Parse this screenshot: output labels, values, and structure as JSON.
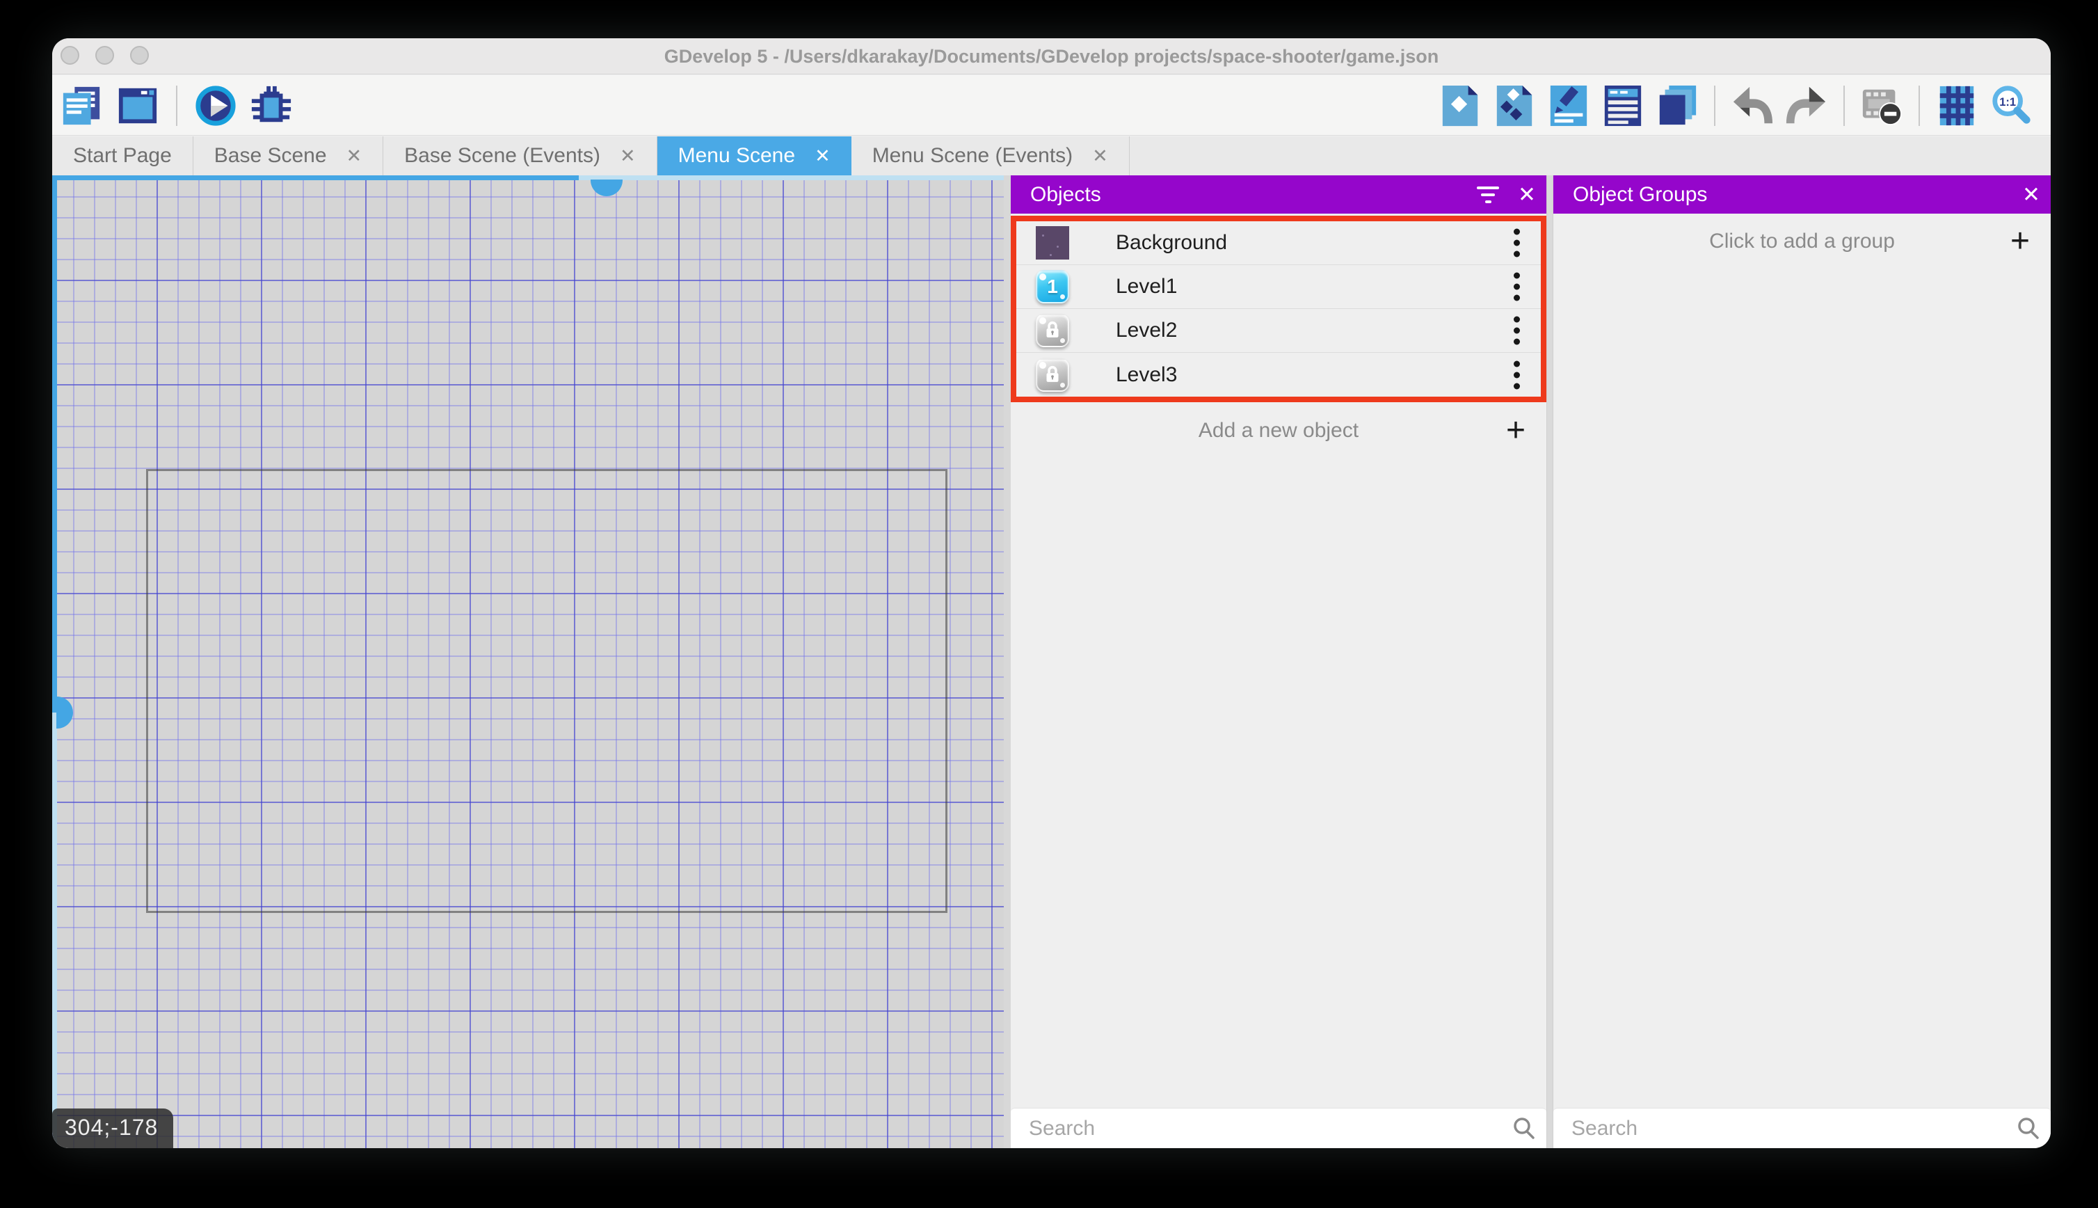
{
  "window": {
    "title": "GDevelop 5 - /Users/dkarakay/Documents/GDevelop projects/space-shooter/game.json"
  },
  "glyphs": {
    "close": "✕",
    "plus": "+"
  },
  "toolbar": {
    "left_icons": [
      "project-manager-icon",
      "scene-window-icon",
      "play-icon",
      "debug-bug-icon"
    ],
    "right_icons": [
      "objects-panel-icon",
      "instances-panel-icon",
      "properties-panel-icon",
      "layers-panel-icon",
      "instances-list-icon",
      "undo-icon",
      "redo-icon",
      "toggle-mask-icon",
      "toggle-grid-icon",
      "zoom-1-1-icon"
    ]
  },
  "tabs": [
    {
      "label": "Start Page",
      "active": false,
      "closable": false
    },
    {
      "label": "Base Scene",
      "active": false,
      "closable": true
    },
    {
      "label": "Base Scene (Events)",
      "active": false,
      "closable": true
    },
    {
      "label": "Menu Scene",
      "active": true,
      "closable": true
    },
    {
      "label": "Menu Scene (Events)",
      "active": false,
      "closable": true
    }
  ],
  "canvas": {
    "coordinates_label": "304;-178"
  },
  "objects_panel": {
    "title": "Objects",
    "items": [
      {
        "name": "Background",
        "icon": "background-sprite-thumbnail"
      },
      {
        "name": "Level1",
        "icon": "level1-button-thumbnail",
        "badge": "1"
      },
      {
        "name": "Level2",
        "icon": "locked-button-thumbnail"
      },
      {
        "name": "Level3",
        "icon": "locked-button-thumbnail"
      }
    ],
    "add_label": "Add a new object",
    "search_placeholder": "Search"
  },
  "groups_panel": {
    "title": "Object Groups",
    "add_label": "Click to add a group",
    "search_placeholder": "Search"
  },
  "colors": {
    "accent_blue": "#4AA9E6",
    "panel_header_purple": "#9506CB",
    "highlight_red": "#EE3A1C",
    "icon_navy": "#2B3C8E",
    "icon_blue": "#4FA8E0"
  }
}
